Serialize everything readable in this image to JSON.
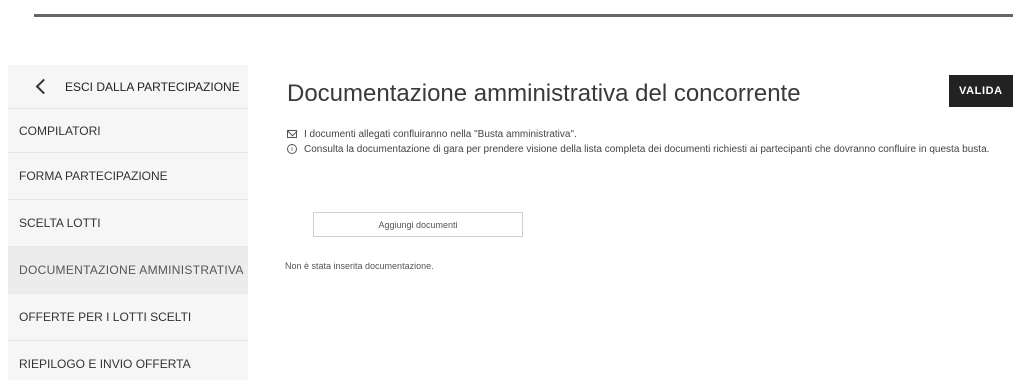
{
  "sidebar": {
    "exit_label": "ESCI DALLA PARTECIPAZIONE",
    "items": [
      {
        "label": "COMPILATORI"
      },
      {
        "label": "FORMA PARTECIPAZIONE"
      },
      {
        "label": "SCELTA LOTTI"
      },
      {
        "label": "DOCUMENTAZIONE AMMINISTRATIVA"
      },
      {
        "label": "OFFERTE PER I LOTTI SCELTI"
      },
      {
        "label": "RIEPILOGO E INVIO OFFERTA"
      }
    ]
  },
  "main": {
    "title": "Documentazione amministrativa del concorrente",
    "valida_label": "VALIDA",
    "info_mail": "I documenti allegati confluiranno nella \"Busta amministrativa\".",
    "info_note": "Consulta la documentazione di gara per prendere visione della lista completa dei documenti richiesti ai partecipanti che dovranno confluire in questa busta.",
    "add_button_label": "Aggiungi documenti",
    "empty_message": "Non è stata inserita documentazione."
  },
  "icons": {
    "exit": "chevron-left-icon",
    "mail": "envelope-icon",
    "info": "info-icon"
  }
}
